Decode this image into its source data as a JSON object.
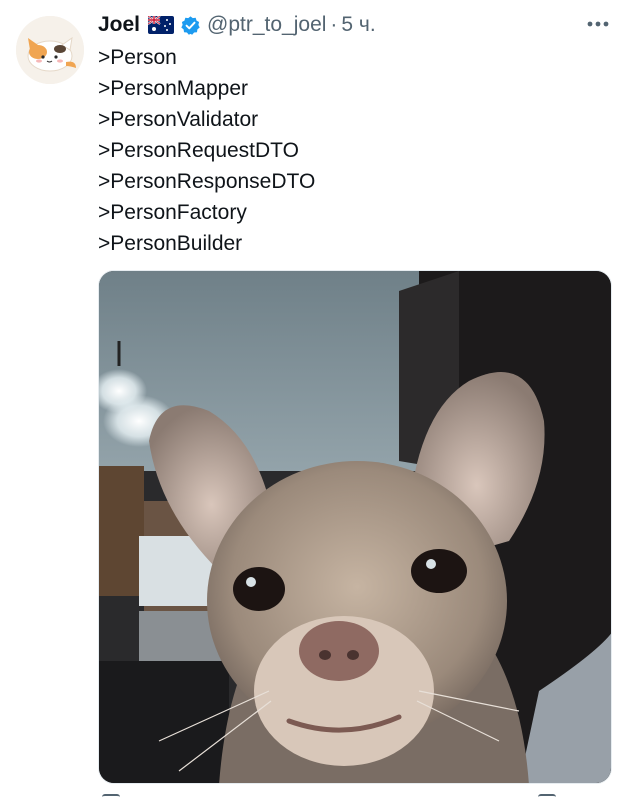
{
  "tweet": {
    "display_name": "Joel",
    "handle": "@ptr_to_joel",
    "separator": "·",
    "time": "5 ч.",
    "flag_icon": "australia-flag-icon",
    "verified_icon": "verified-badge-icon",
    "verified_color": "#1d9bf0",
    "lines": [
      ">Person",
      ">PersonMapper",
      ">PersonValidator",
      ">PersonRequestDTO",
      ">PersonResponseDTO",
      ">PersonFactory",
      ">PersonBuilder"
    ],
    "media_icon": "chihuahua-photo",
    "avatar_icon": "calico-cat-avatar",
    "more_icon": "more-options-icon"
  },
  "colors": {
    "text_primary": "#0f1419",
    "text_secondary": "#536471",
    "accent": "#1d9bf0"
  }
}
